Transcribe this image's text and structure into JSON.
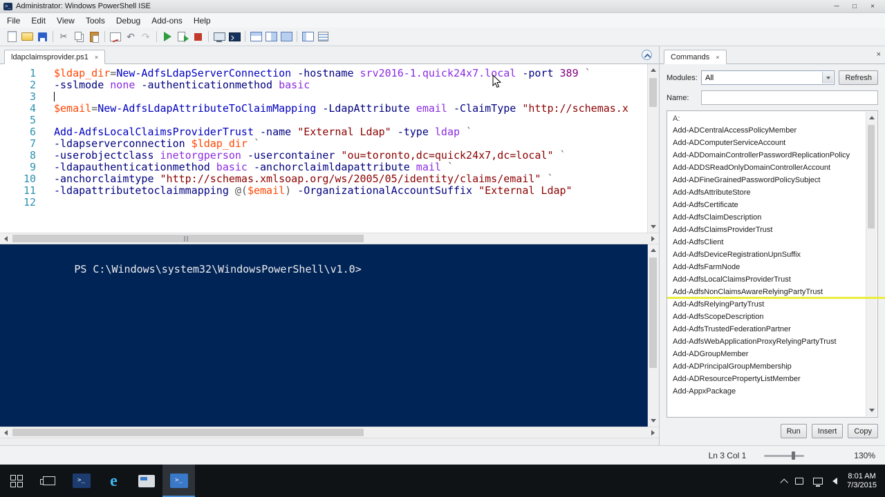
{
  "window": {
    "title": "Administrator: Windows PowerShell ISE",
    "minimize_glyph": "─",
    "maximize_glyph": "□",
    "close_glyph": "×"
  },
  "menu": {
    "items": [
      "File",
      "Edit",
      "View",
      "Tools",
      "Debug",
      "Add-ons",
      "Help"
    ]
  },
  "toolbar": {
    "icons": [
      {
        "name": "new-script-icon",
        "cls": "i-new"
      },
      {
        "name": "open-script-icon",
        "cls": "i-open"
      },
      {
        "name": "save-icon",
        "cls": "i-save"
      },
      {
        "name": "toolbar-separator",
        "cls": "sep"
      },
      {
        "name": "cut-icon",
        "cls": "i-cut"
      },
      {
        "name": "copy-icon",
        "cls": "i-copy"
      },
      {
        "name": "paste-icon",
        "cls": "i-paste"
      },
      {
        "name": "toolbar-separator",
        "cls": "sep"
      },
      {
        "name": "clear-console-icon",
        "cls": "i-clear"
      },
      {
        "name": "undo-icon",
        "cls": "i-undo"
      },
      {
        "name": "redo-icon",
        "cls": "i-redo"
      },
      {
        "name": "toolbar-separator",
        "cls": "sep"
      },
      {
        "name": "run-script-icon",
        "cls": "i-run"
      },
      {
        "name": "run-selection-icon",
        "cls": "i-runsel"
      },
      {
        "name": "stop-operation-icon",
        "cls": "i-stop"
      },
      {
        "name": "toolbar-separator",
        "cls": "sep"
      },
      {
        "name": "new-remote-powershell-tab-icon",
        "cls": "i-remote"
      },
      {
        "name": "start-powershell-icon",
        "cls": "i-psexe"
      },
      {
        "name": "toolbar-separator",
        "cls": "sep"
      },
      {
        "name": "script-pane-top-icon",
        "cls": "i-paneTop"
      },
      {
        "name": "script-pane-right-icon",
        "cls": "i-paneRight"
      },
      {
        "name": "script-pane-maximized-icon",
        "cls": "i-paneMax"
      },
      {
        "name": "toolbar-separator",
        "cls": "sep"
      },
      {
        "name": "show-command-addon-icon",
        "cls": "i-cmdpane"
      },
      {
        "name": "show-command-window-icon",
        "cls": "i-cmdwin"
      }
    ]
  },
  "editor": {
    "tab_label": "ldapclaimsprovider.ps1",
    "tab_close_glyph": "×",
    "lines": [
      {
        "num": 1,
        "tokens": [
          [
            "v",
            "$ldap_dir"
          ],
          [
            "o",
            "="
          ],
          [
            "c",
            "New-AdfsLdapServerConnection"
          ],
          [
            "p",
            " -hostname"
          ],
          [
            "a",
            " srv2016-1.quick24x7.local"
          ],
          [
            "p",
            " -port"
          ],
          [
            "n",
            " 389"
          ],
          [
            "o",
            " `"
          ]
        ]
      },
      {
        "num": 2,
        "tokens": [
          [
            "p",
            "-sslmode"
          ],
          [
            "a",
            " none"
          ],
          [
            "p",
            " -authenticationmethod"
          ],
          [
            "a",
            " basic"
          ]
        ]
      },
      {
        "num": 3,
        "tokens": [],
        "caret": true
      },
      {
        "num": 4,
        "tokens": [
          [
            "v",
            "$email"
          ],
          [
            "o",
            "="
          ],
          [
            "c",
            "New-AdfsLdapAttributeToClaimMapping"
          ],
          [
            "p",
            " -LdapAttribute"
          ],
          [
            "a",
            " email"
          ],
          [
            "p",
            " -ClaimType"
          ],
          [
            "s",
            " \"http://schemas.x"
          ]
        ]
      },
      {
        "num": 5,
        "tokens": []
      },
      {
        "num": 6,
        "tokens": [
          [
            "c",
            "Add-AdfsLocalClaimsProviderTrust"
          ],
          [
            "p",
            " -name"
          ],
          [
            "s",
            " \"External Ldap\""
          ],
          [
            "p",
            " -type"
          ],
          [
            "a",
            " ldap"
          ],
          [
            "o",
            " `"
          ]
        ]
      },
      {
        "num": 7,
        "tokens": [
          [
            "p",
            "-ldapserverconnection"
          ],
          [
            "v",
            " $ldap_dir"
          ],
          [
            "o",
            " `"
          ]
        ]
      },
      {
        "num": 8,
        "tokens": [
          [
            "p",
            "-userobjectclass"
          ],
          [
            "a",
            " inetorgperson"
          ],
          [
            "p",
            " -usercontainer"
          ],
          [
            "s",
            " \"ou=toronto,dc=quick24x7,dc=local\""
          ],
          [
            "o",
            " `"
          ]
        ]
      },
      {
        "num": 9,
        "tokens": [
          [
            "p",
            "-ldapauthenticationmethod"
          ],
          [
            "a",
            " basic"
          ],
          [
            "p",
            " -anchorclaimldapattribute"
          ],
          [
            "a",
            " mail"
          ],
          [
            "o",
            " `"
          ]
        ]
      },
      {
        "num": 10,
        "tokens": [
          [
            "p",
            "-anchorclaimtype"
          ],
          [
            "s",
            " \"http://schemas.xmlsoap.org/ws/2005/05/identity/claims/email\""
          ],
          [
            "o",
            " `"
          ]
        ]
      },
      {
        "num": 11,
        "tokens": [
          [
            "p",
            "-ldapattributetoclaimmapping"
          ],
          [
            "o",
            " @("
          ],
          [
            "v",
            "$email"
          ],
          [
            "o",
            ")"
          ],
          [
            "p",
            " -OrganizationalAccountSuffix"
          ],
          [
            "s",
            " \"External Ldap\""
          ]
        ]
      },
      {
        "num": 12,
        "tokens": []
      }
    ]
  },
  "console": {
    "prompt": "PS C:\\Windows\\system32\\WindowsPowerShell\\v1.0>"
  },
  "commands_panel": {
    "tab_label": "Commands",
    "tab_close_glyph": "×",
    "pane_close_glyph": "×",
    "modules_label": "Modules:",
    "modules_value": "All",
    "refresh_button": "Refresh",
    "name_label": "Name:",
    "name_value": "",
    "group_header": "A:",
    "items": [
      "Add-ADCentralAccessPolicyMember",
      "Add-ADComputerServiceAccount",
      "Add-ADDomainControllerPasswordReplicationPolicy",
      "Add-ADDSReadOnlyDomainControllerAccount",
      "Add-ADFineGrainedPasswordPolicySubject",
      "Add-AdfsAttributeStore",
      "Add-AdfsCertificate",
      "Add-AdfsClaimDescription",
      "Add-AdfsClaimsProviderTrust",
      "Add-AdfsClient",
      "Add-AdfsDeviceRegistrationUpnSuffix",
      "Add-AdfsFarmNode",
      "Add-AdfsLocalClaimsProviderTrust",
      "Add-AdfsNonClaimsAwareRelyingPartyTrust",
      "Add-AdfsRelyingPartyTrust",
      "Add-AdfsScopeDescription",
      "Add-AdfsTrustedFederationPartner",
      "Add-AdfsWebApplicationProxyRelyingPartyTrust",
      "Add-ADGroupMember",
      "Add-ADPrincipalGroupMembership",
      "Add-ADResourcePropertyListMember",
      "Add-AppxPackage"
    ],
    "highlighted_item": "Add-AdfsNonClaimsAwareRelyingPartyTrust",
    "run_button": "Run",
    "insert_button": "Insert",
    "copy_button": "Copy"
  },
  "status_bar": {
    "position": "Ln 3 Col 1",
    "zoom_percent": "130%"
  },
  "taskbar": {
    "ie_glyph": "e",
    "powershell_glyph": ">_",
    "ise_glyph": ">_",
    "clock_time": "8:01 AM",
    "clock_date": "7/3/2015"
  },
  "colors": {
    "console_bg": "#012456",
    "highlight_yellow": "#e9ee3a",
    "cmdlet": "#0000c0",
    "parameter": "#000080",
    "argument": "#8a2be2",
    "variable": "#ff4500",
    "string": "#8b0000",
    "operator": "#5a5a5a",
    "number": "#800080",
    "line_number": "#2b91af"
  }
}
